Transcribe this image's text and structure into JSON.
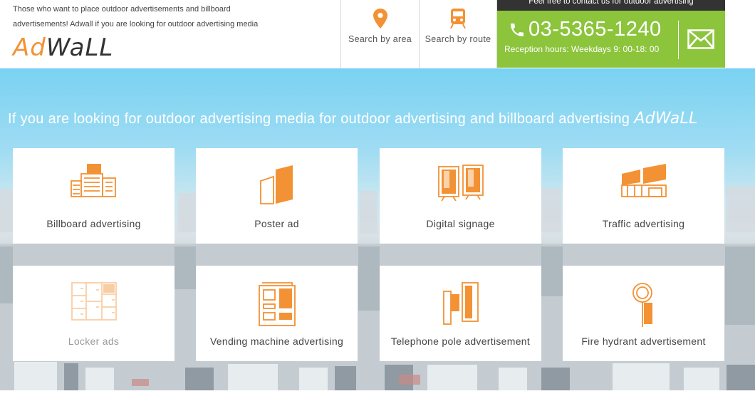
{
  "header": {
    "tagline": "Those who want to place outdoor advertisements and billboard advertisements! Adwall if you are looking for outdoor advertising media",
    "logo": {
      "part1": "Ad",
      "part2": "WaLL"
    },
    "nav": [
      {
        "label": "Search by area",
        "icon": "map-pin-icon"
      },
      {
        "label": "Search by route",
        "icon": "train-icon"
      }
    ],
    "contact": {
      "banner": "Feel free to contact us for outdoor advertising",
      "phone": "03-5365-1240",
      "hours": "Reception hours: Weekdays 9: 00-18: 00",
      "mail_icon": "envelope-icon"
    }
  },
  "hero": {
    "title": "If you are looking for outdoor advertising media for outdoor advertising and billboard advertising",
    "logo": "AdWaLL"
  },
  "categories": [
    {
      "label": "Billboard advertising",
      "icon": "billboard-building-icon"
    },
    {
      "label": "Poster ad",
      "icon": "poster-icon"
    },
    {
      "label": "Digital signage",
      "icon": "digital-signage-icon"
    },
    {
      "label": "Traffic advertising",
      "icon": "traffic-ad-icon"
    },
    {
      "label": "Locker ads",
      "icon": "locker-icon"
    },
    {
      "label": "Vending machine advertising",
      "icon": "vending-machine-icon"
    },
    {
      "label": "Telephone pole advertisement",
      "icon": "telephone-pole-icon"
    },
    {
      "label": "Fire hydrant advertisement",
      "icon": "fire-hydrant-icon"
    }
  ],
  "colors": {
    "accent": "#f39234",
    "contact_green": "#8cc43c",
    "sky": "#79d2f2"
  }
}
